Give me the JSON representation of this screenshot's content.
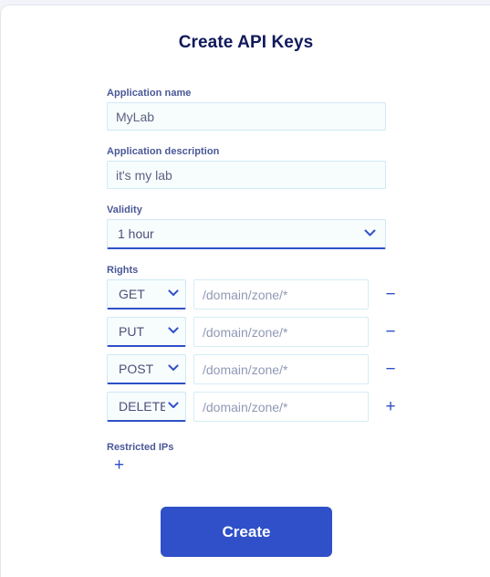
{
  "page": {
    "title": "Create API Keys"
  },
  "form": {
    "application_name": {
      "label": "Application name",
      "value": "MyLab",
      "placeholder": ""
    },
    "application_description": {
      "label": "Application description",
      "value": "it's my lab",
      "placeholder": ""
    },
    "validity": {
      "label": "Validity",
      "value": "1 hour",
      "options": [
        "1 hour"
      ]
    },
    "rights": {
      "label": "Rights",
      "verb_options": [
        "GET",
        "PUT",
        "POST",
        "DELETE"
      ],
      "rows": [
        {
          "verb": "GET",
          "path": "/domain/zone/*",
          "path_placeholder": "/domain/zone/*",
          "action": "−",
          "action_name": "remove"
        },
        {
          "verb": "PUT",
          "path": "/domain/zone/*",
          "path_placeholder": "/domain/zone/*",
          "action": "−",
          "action_name": "remove"
        },
        {
          "verb": "POST",
          "path": "/domain/zone/*",
          "path_placeholder": "/domain/zone/*",
          "action": "−",
          "action_name": "remove"
        },
        {
          "verb": "DELETE",
          "path": "/domain/zone/*",
          "path_placeholder": "/domain/zone/*",
          "action": "+",
          "action_name": "add"
        }
      ]
    },
    "restricted_ips": {
      "label": "Restricted IPs",
      "add_label": "+"
    }
  },
  "actions": {
    "create_label": "Create"
  },
  "colors": {
    "accent": "#2f50c8",
    "title": "#10195b",
    "label": "#4a5797",
    "field_border": "#cfe9f3",
    "field_bg": "#f7fcfd",
    "page_bg": "#f3f3fa"
  },
  "icons": {
    "chevron_down": "chevron-down-icon",
    "minus": "minus-icon",
    "plus": "plus-icon"
  }
}
